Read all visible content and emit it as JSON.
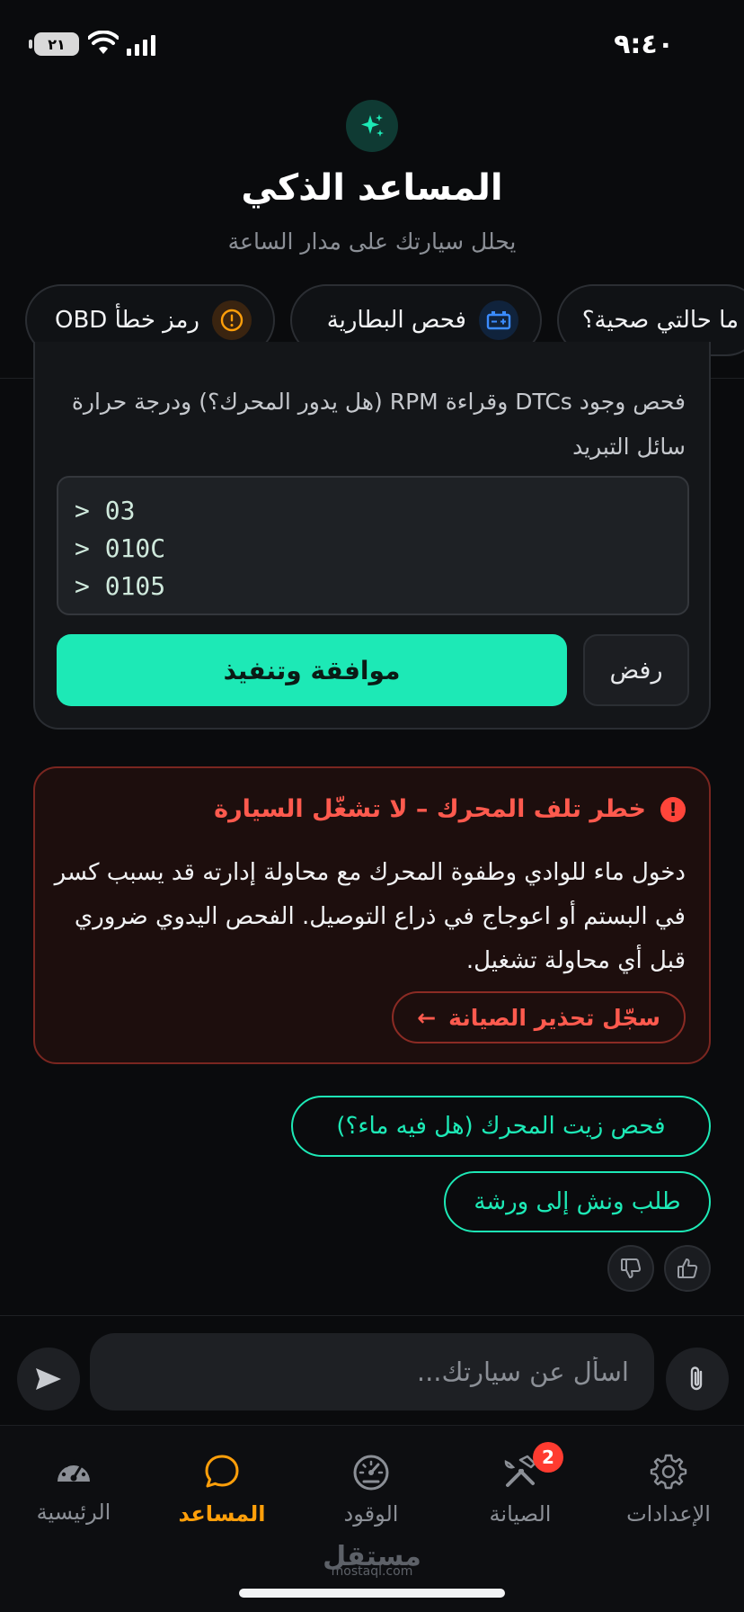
{
  "status_bar": {
    "time": "٩:٤٠",
    "battery": "٢١"
  },
  "header": {
    "title": "المساعد الذكي",
    "subtitle": "يحلل سيارتك على مدار الساعة",
    "icon": "sparkles-icon"
  },
  "chips": [
    {
      "label": "رمز خطأ OBD",
      "icon": "alert-circle-icon"
    },
    {
      "label": "فحص البطارية",
      "icon": "battery-icon"
    },
    {
      "label": "ما حالتي صحية؟"
    }
  ],
  "approval": {
    "description": "فحص وجود DTCs وقراءة RPM (هل يدور المحرك؟) ودرجة حرارة سائل التبريد",
    "commands": [
      "> 03",
      "> 010C",
      "> 0105"
    ],
    "approve_label": "موافقة وتنفيذ",
    "reject_label": "رفض"
  },
  "danger": {
    "title": "خطر تلف المحرك – لا تشغّل السيارة",
    "body": "دخول ماء للوادي وطفوة المحرك مع محاولة إدارته قد يسبب كسر في البستم أو اعوجاج في ذراع التوصيل. الفحص اليدوي ضروري قبل أي محاولة تشغيل.",
    "action_label": "سجّل تحذير الصيانة",
    "action_arrow": "←"
  },
  "suggestions": [
    "فحص زيت المحرك (هل فيه ماء؟)",
    "طلب ونش إلى ورشة"
  ],
  "composer": {
    "placeholder": "اسأل عن سيارتك..."
  },
  "tabs": {
    "home": "الرئيسية",
    "assistant": "المساعد",
    "fuel": "الوقود",
    "maintenance": "الصيانة",
    "maintenance_badge": "2",
    "settings": "الإعدادات"
  },
  "watermark": {
    "name": "مستقل",
    "url": "mostaql.com"
  },
  "colors": {
    "accent": "#1de9b6",
    "danger": "#ff5a4e",
    "active_tab": "#ff9f0a"
  }
}
